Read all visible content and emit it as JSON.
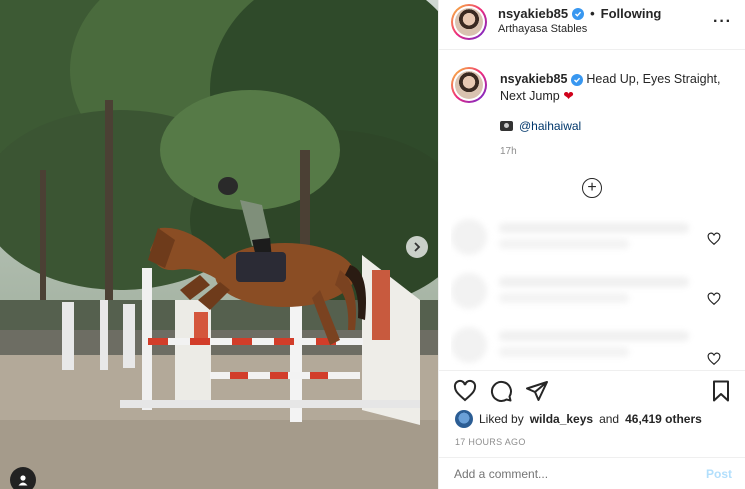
{
  "post": {
    "username": "nsyakieb85",
    "follow_status": "Following",
    "separator": "•",
    "location": "Arthayasa Stables",
    "more_glyph": "···"
  },
  "caption": {
    "username": "nsyakieb85",
    "text": "Head Up, Eyes Straight, Next Jump",
    "emoji": "❤",
    "credit_mention": "@haihaiwal",
    "time": "17h",
    "load_more_glyph": "+"
  },
  "actions": {
    "liked_prefix": "Liked by",
    "liked_user": "wilda_keys",
    "liked_and": "and",
    "liked_count": "46,419 others",
    "timestamp": "17 HOURS AGO"
  },
  "comment": {
    "placeholder": "Add a comment...",
    "post_label": "Post"
  },
  "colors": {
    "verified": "#3897f0",
    "link": "#00376b",
    "post_disabled": "#b2dffc",
    "heart_emoji": "#d0021b"
  },
  "icons": {
    "like": "heart-icon",
    "comment": "comment-icon",
    "share": "paper-plane-icon",
    "save": "bookmark-icon"
  }
}
